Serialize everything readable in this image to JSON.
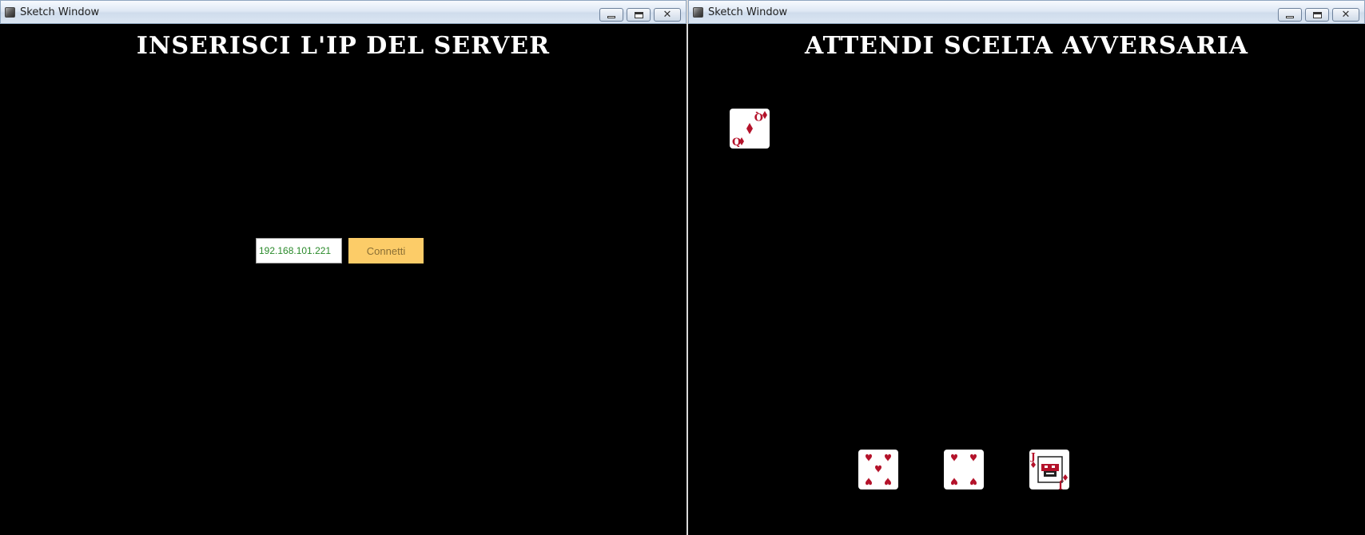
{
  "windows": [
    {
      "title": "Sketch Window",
      "heading": "INSERISCI L'IP DEL SERVER",
      "ip_input": {
        "value": "192.168.101.221"
      },
      "connect_button": {
        "label": "Connetti"
      }
    },
    {
      "title": "Sketch Window",
      "heading": "ATTENDI SCELTA AVVERSARIA",
      "table_card": {
        "rank": "Q",
        "suit": "diamonds"
      },
      "hand_cards": [
        {
          "rank": "5",
          "suit": "hearts"
        },
        {
          "rank": "4",
          "suit": "hearts"
        },
        {
          "rank": "J",
          "suit": "diamonds"
        }
      ]
    }
  ],
  "colors": {
    "background": "#000000",
    "button": "#fccc68",
    "button_text": "#8a6f35",
    "input_text": "#2a8a2a",
    "card_red": "#b4122a"
  },
  "icons": [
    "app-icon",
    "minimize-icon",
    "maximize-icon",
    "close-icon"
  ]
}
